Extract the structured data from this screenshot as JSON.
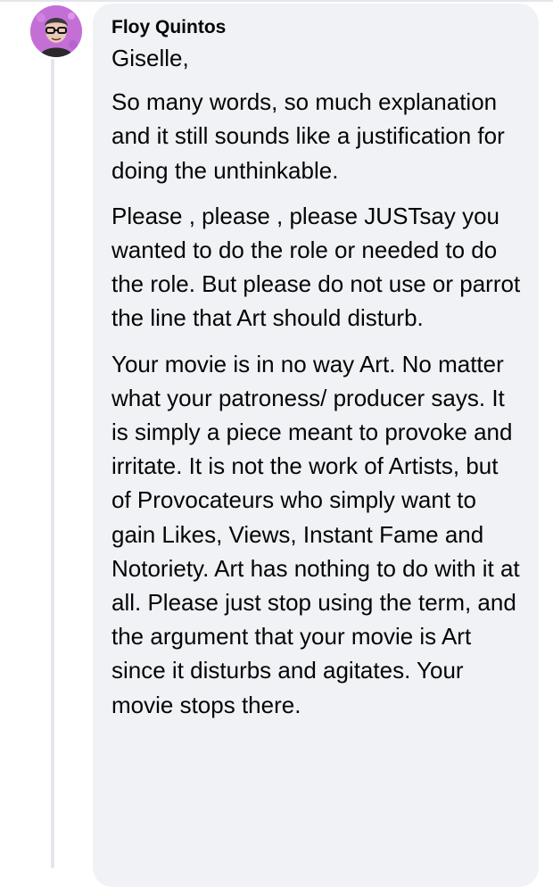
{
  "comment": {
    "author": "Floy Quintos",
    "avatar_icon": "user-avatar-photo",
    "greeting": "Giselle,",
    "paragraph_1": "So many words, so much explanation and it still sounds like a justification for doing the unthinkable.",
    "paragraph_2": "Please , please , please JUSTsay you wanted to do the role or needed to do the role. But please do not use or parrot the line that Art should disturb.",
    "paragraph_3": "Your movie is in no way Art. No matter what your patroness/ producer says. It is simply a piece meant to provoke and irritate. It is not the work of Artists, but of Provocateurs who simply want to gain Likes, Views, Instant Fame and Notoriety. Art has nothing to do with it at all. Please just stop using the term, and the argument that your movie is Art since it disturbs and agitates. Your movie stops there."
  },
  "colors": {
    "bubble_bg": "#f0f2f5",
    "text": "#050505",
    "avatar_bg": "#c46fd6"
  }
}
